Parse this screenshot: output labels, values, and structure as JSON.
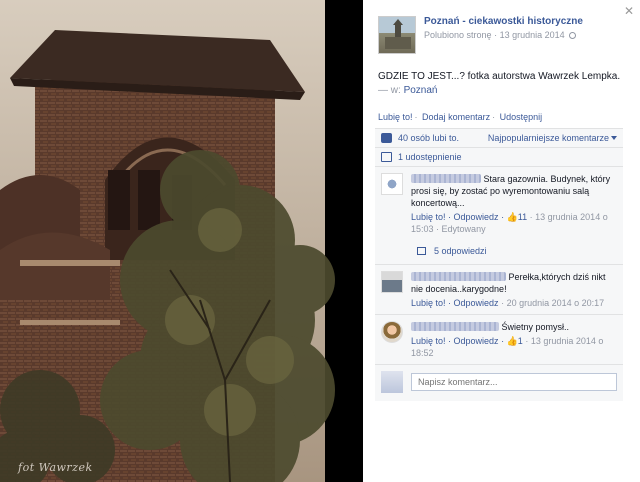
{
  "photo": {
    "credit": "fot Wawrzek"
  },
  "post": {
    "page_name": "Poznań - ciekawostki historyczne",
    "liked": "Polubiono stronę",
    "date": "13 grudnia 2014",
    "caption_text": "GDZIE TO JEST...? fotka autorstwa Wawrzek Lempka.",
    "caption_with": "— w:",
    "caption_place": "Poznań"
  },
  "actions": {
    "like": "Lubię to!",
    "comment": "Dodaj komentarz",
    "share": "Udostępnij"
  },
  "summary": {
    "likes": "40 osób lubi to.",
    "sort": "Najpopularniejsze komentarze",
    "shares": "1 udostępnienie"
  },
  "comments": [
    {
      "text": "Stara gazownia. Budynek, który prosi się, by zostać po wyremontowaniu salą koncertową...",
      "like": "Lubię to!",
      "reply": "Odpowiedz",
      "count": "11",
      "date": "13 grudnia 2014 o 15:03",
      "edited": "Edytowany",
      "replies": "5 odpowiedzi"
    },
    {
      "text": "Perełka,których dziś nikt nie docenia..karygodne!",
      "like": "Lubię to!",
      "reply": "Odpowiedz",
      "date": "20 grudnia 2014 o 20:17"
    },
    {
      "text": "Świetny pomysł..",
      "like": "Lubię to!",
      "reply": "Odpowiedz",
      "count": "1",
      "date": "13 grudnia 2014 o 18:52"
    }
  ],
  "composer": {
    "placeholder": "Napisz komentarz..."
  },
  "icons": [
    "close-icon",
    "globe-icon",
    "thumbs-up-icon",
    "share-icon",
    "reply-icon"
  ]
}
